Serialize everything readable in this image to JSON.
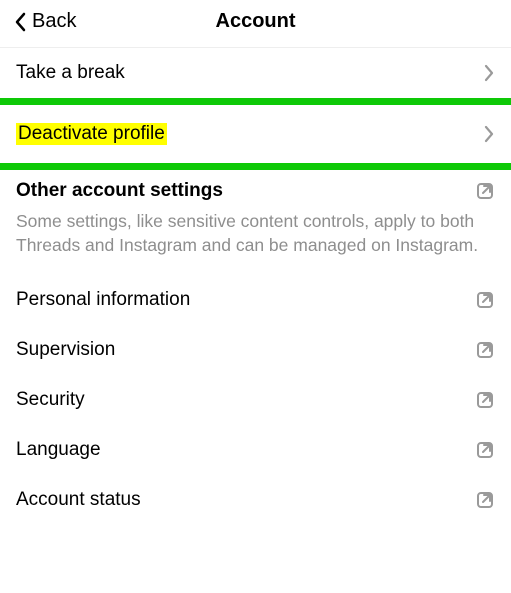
{
  "header": {
    "back_label": "Back",
    "title": "Account"
  },
  "rows": {
    "take_break": "Take a break",
    "deactivate": "Deactivate profile"
  },
  "section": {
    "title": "Other account settings",
    "desc": "Some settings, like sensitive content controls, apply to both Threads and Instagram and can be managed on Instagram."
  },
  "links": {
    "personal_info": "Personal information",
    "supervision": "Supervision",
    "security": "Security",
    "language": "Language",
    "account_status": "Account status"
  }
}
